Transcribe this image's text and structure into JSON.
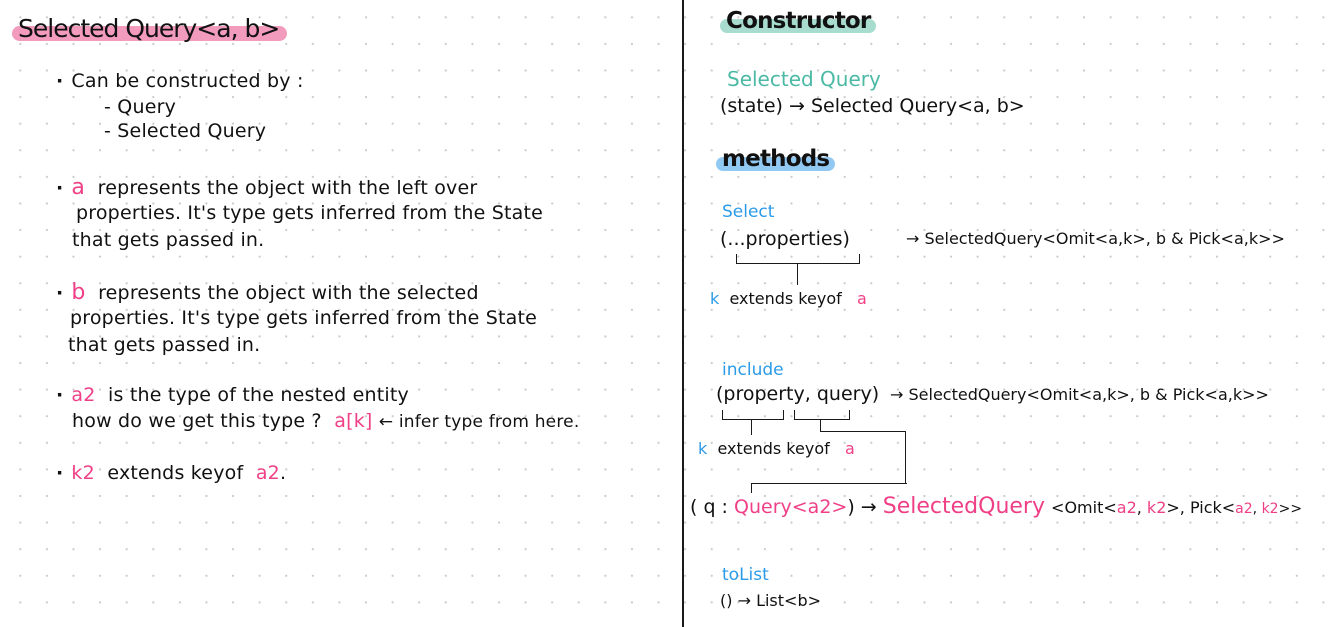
{
  "left": {
    "title": "Selected Query<a, b>",
    "highlight_color": "#f29bbd",
    "constructed_by": {
      "label": "Can be constructed by :",
      "items": [
        "- Query",
        "- Selected Query"
      ]
    },
    "notes": [
      {
        "var": "a",
        "lines": [
          "represents the object with the left over",
          "properties. It's type gets inferred from the State",
          "that gets passed in."
        ]
      },
      {
        "var": "b",
        "lines": [
          "represents the object with the selected",
          "properties. It's type gets inferred from the State",
          "that gets passed in."
        ]
      },
      {
        "var": "a2",
        "line1_rest": "is the type of the nested entity",
        "line2_pre": "how do we get this type ?",
        "line2_code": "a[k]",
        "line2_post": "← infer type from here."
      },
      {
        "var": "k2",
        "mid": "extends keyof",
        "var2": "a2",
        "end": "."
      }
    ]
  },
  "right": {
    "constructor": {
      "heading": "Constructor",
      "highlight_color": "#a7dccf",
      "name": "Selected Query",
      "signature": "(state) → Selected Query<a, b>"
    },
    "methods": {
      "heading": "methods",
      "highlight_color": "#92c9f2",
      "select": {
        "name": "Select",
        "params": "(...properties)",
        "returns": "→ SelectedQuery<Omit<a,k>, b & Pick<a,k>>",
        "note_var": "k",
        "note_mid": "extends keyof",
        "note_var2": "a"
      },
      "include": {
        "name": "include",
        "params_1": "(property,",
        "params_2": "query)",
        "returns": "→ SelectedQuery<Omit<a,k>, b & Pick<a,k>>",
        "note_var": "k",
        "note_mid": "extends keyof",
        "note_var2": "a",
        "q_sig": {
          "open": "( q :",
          "type": "Query<a2>",
          "close": ") →",
          "ret_name": "SelectedQuery",
          "ret_open": "<Omit<",
          "a2_1": "a2",
          "comma1": ", ",
          "k2_1": "k2",
          "mid": ">, Pick<",
          "a2_2": "a2",
          "comma2": ", ",
          "k2_2": "k2",
          "end": ">>"
        }
      },
      "toList": {
        "name": "toList",
        "signature": "() → List<b>"
      }
    }
  },
  "colors": {
    "pink": "#ef3f86",
    "blue": "#2b9be8",
    "teal": "#4bb9a4"
  }
}
